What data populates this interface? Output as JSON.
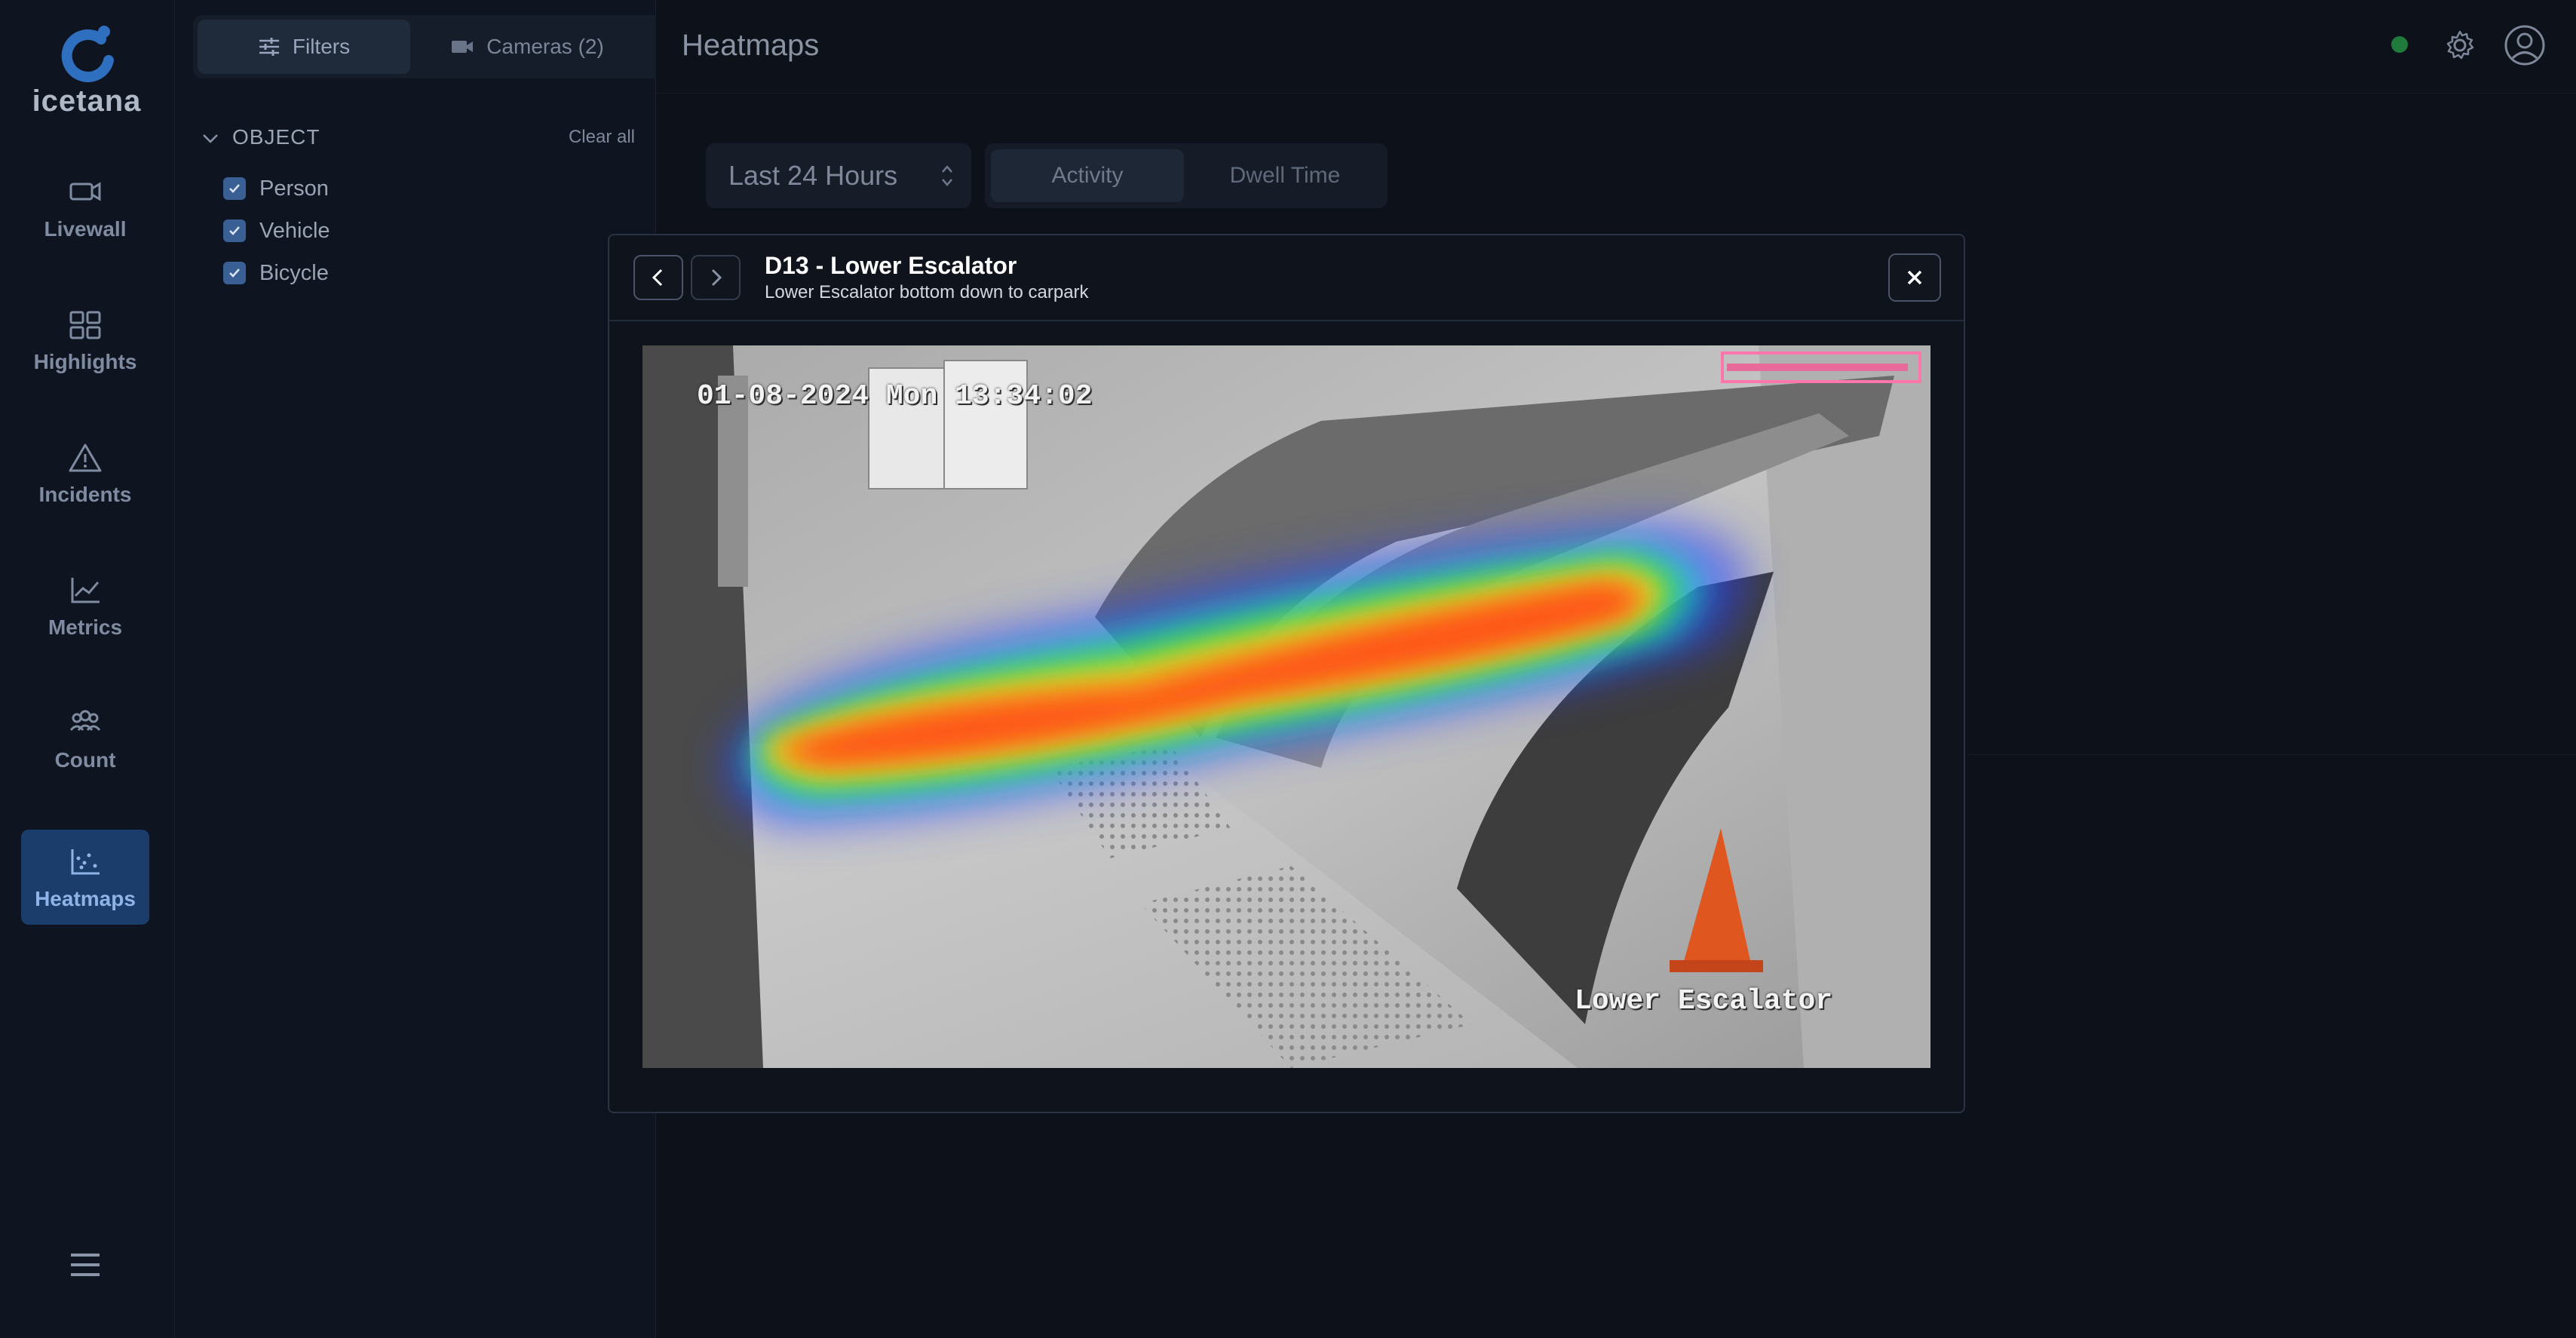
{
  "brand": {
    "name": "icetana",
    "accent": "#2f6fbf"
  },
  "nav": {
    "items": [
      {
        "label": "Livewall",
        "icon": "camera-icon"
      },
      {
        "label": "Highlights",
        "icon": "grid-icon"
      },
      {
        "label": "Incidents",
        "icon": "warning-icon"
      },
      {
        "label": "Metrics",
        "icon": "line-chart-icon"
      },
      {
        "label": "Count",
        "icon": "people-icon"
      },
      {
        "label": "Heatmaps",
        "icon": "heatmap-icon",
        "active": true
      }
    ]
  },
  "panel": {
    "tabs": {
      "filters": "Filters",
      "cameras": "Cameras (2)"
    },
    "group": {
      "title": "OBJECT",
      "clear_label": "Clear all",
      "options": [
        {
          "label": "Person",
          "checked": true
        },
        {
          "label": "Vehicle",
          "checked": true
        },
        {
          "label": "Bicycle",
          "checked": true
        }
      ]
    }
  },
  "header": {
    "title": "Heatmaps",
    "status_color": "#1f7a3c"
  },
  "controls": {
    "time_range": "Last 24 Hours",
    "modes": {
      "activity": "Activity",
      "dwell": "Dwell Time"
    }
  },
  "modal": {
    "title": "D13 - Lower Escalator",
    "subtitle": "Lower Escalator bottom down to carpark",
    "camera": {
      "timestamp": "01-08-2024 Mon 13:34:02",
      "overlay_name": "Lower Escalator"
    }
  }
}
